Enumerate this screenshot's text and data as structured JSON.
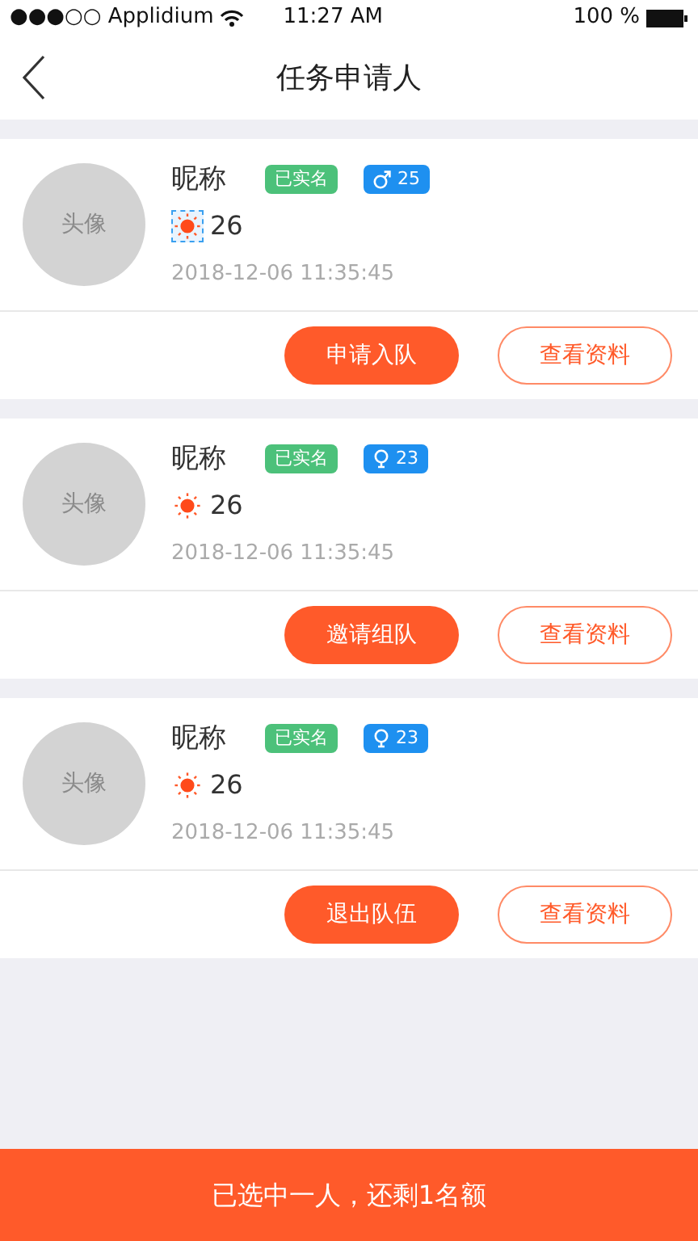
{
  "status_bar": {
    "carrier": "●●●○○ Applidium",
    "time": "11:27 AM",
    "battery": "100 %"
  },
  "nav": {
    "title": "任务申请人"
  },
  "applicants": [
    {
      "avatar": "头像",
      "nickname": "昵称",
      "verified": "已实名",
      "kind": "male",
      "age": "25",
      "sun_outlined": true,
      "score": "26",
      "time": "2018-12-06 11:35:45",
      "primary_action": "申请入队",
      "secondary_action": "查看资料"
    },
    {
      "avatar": "头像",
      "nickname": "昵称",
      "verified": "已实名",
      "kind": "female",
      "age": "23",
      "sun_outlined": false,
      "score": "26",
      "time": "2018-12-06 11:35:45",
      "primary_action": "邀请组队",
      "secondary_action": "查看资料"
    },
    {
      "avatar": "头像",
      "nickname": "昵称",
      "verified": "已实名",
      "kind": "female",
      "age": "23",
      "sun_outlined": false,
      "score": "26",
      "time": "2018-12-06 11:35:45",
      "primary_action": "退出队伍",
      "secondary_action": "查看资料"
    }
  ],
  "footer": {
    "label": "已选中一人，还剩1名额"
  }
}
